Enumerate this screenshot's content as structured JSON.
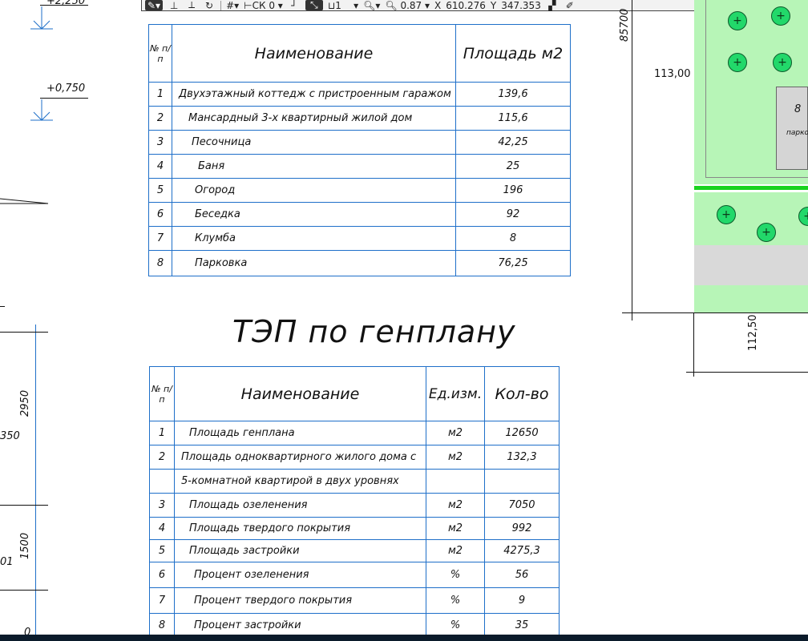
{
  "toolbar": {
    "cs_label": "СК 0",
    "layer_value": "1",
    "zoom_value": "0.87",
    "x_label": "X",
    "x_value": "610.276",
    "y_label": "Y",
    "y_value": "347.353"
  },
  "left_drawing": {
    "level_top": "+2,250",
    "level_mid": "+0,750",
    "dim_350": "350",
    "dim_2950": "2950",
    "dim_1500": "1500",
    "dim_01": "01",
    "dim_0": "0"
  },
  "table1": {
    "col_num": "№ п/п",
    "col_name": "Наименование",
    "col_area": "Площадь м2",
    "rows": [
      {
        "n": "1",
        "name": "Двухэтажный коттедж с пристроенным гаражом",
        "area": "139,6"
      },
      {
        "n": "2",
        "name": "Мансардный 3-х квартирный жилой дом",
        "area": "115,6"
      },
      {
        "n": "3",
        "name": "Песочница",
        "area": "42,25"
      },
      {
        "n": "4",
        "name": "Баня",
        "area": "25"
      },
      {
        "n": "5",
        "name": "Огород",
        "area": "196"
      },
      {
        "n": "6",
        "name": "Беседка",
        "area": "92"
      },
      {
        "n": "7",
        "name": "Клумба",
        "area": "8"
      },
      {
        "n": "8",
        "name": "Парковка",
        "area": "76,25"
      }
    ]
  },
  "title2": "ТЭП по генплану",
  "table2": {
    "col_num": "№ п/п",
    "col_name": "Наименование",
    "col_unit": "Ед.изм.",
    "col_qty": "Кол-во",
    "rows": [
      {
        "n": "1",
        "name": "Площадь генплана",
        "unit": "м2",
        "qty": "12650"
      },
      {
        "n": "2",
        "name": "Площадь одноквартирного жилого дома с",
        "unit": "м2",
        "qty": "132,3"
      },
      {
        "n": "",
        "name": "5-комнатной квартирой в двух уровнях",
        "unit": "",
        "qty": ""
      },
      {
        "n": "3",
        "name": "Площадь озеленения",
        "unit": "м2",
        "qty": "7050"
      },
      {
        "n": "4",
        "name": "Площадь твердого покрытия",
        "unit": "м2",
        "qty": "992"
      },
      {
        "n": "5",
        "name": "Площадь застройки",
        "unit": "м2",
        "qty": "4275,3"
      },
      {
        "n": "6",
        "name": "Процент озеленения",
        "unit": "%",
        "qty": "56"
      },
      {
        "n": "7",
        "name": "Процент твердого покрытия",
        "unit": "%",
        "qty": "9"
      },
      {
        "n": "8",
        "name": "Процент застройки",
        "unit": "%",
        "qty": "35"
      }
    ]
  },
  "plan": {
    "coord_top": "85700",
    "mark_113": "113,00",
    "mark_112_50": "112,50",
    "building_num": "8",
    "building_label": "парков",
    "green_color": "#b7f5b7",
    "tree_color": "#22d86a"
  }
}
